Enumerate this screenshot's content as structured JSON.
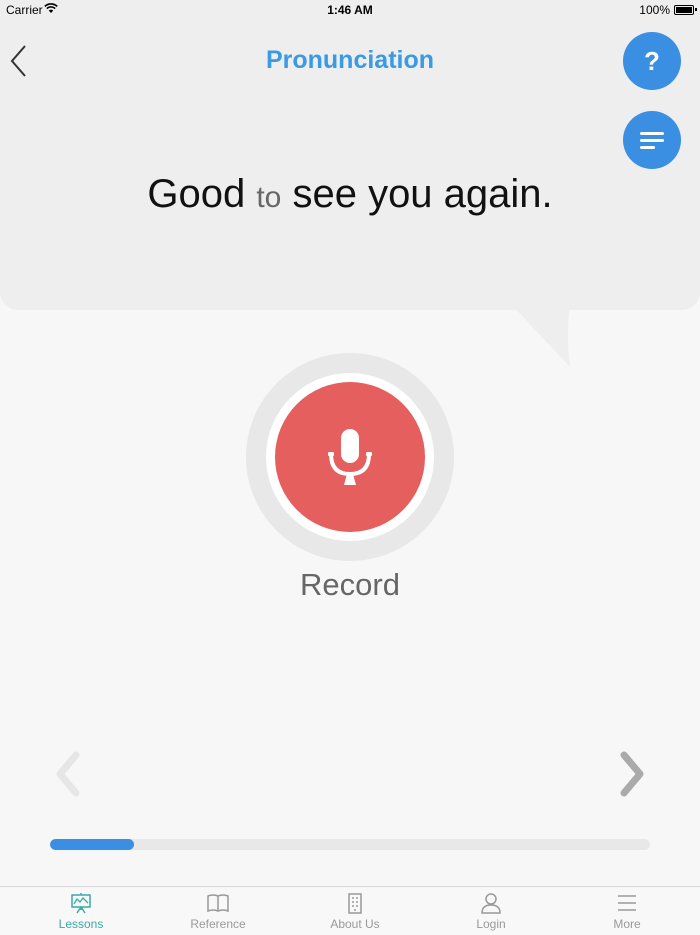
{
  "status_bar": {
    "carrier": "Carrier",
    "time": "1:46 AM",
    "battery": "100%"
  },
  "header": {
    "title": "Pronunciation",
    "help_label": "?"
  },
  "phrase": {
    "before": "Good ",
    "muted": "to",
    "after": " see you again."
  },
  "record": {
    "label": "Record"
  },
  "progress": {
    "value": 0.14
  },
  "colors": {
    "accent": "#3a8fe2",
    "record": "#e45f5d",
    "tab_active": "#3aaba6",
    "tab_inactive": "#999999"
  },
  "tabs": [
    {
      "label": "Lessons",
      "icon": "presentation-board-icon",
      "active": true
    },
    {
      "label": "Reference",
      "icon": "open-book-icon",
      "active": false
    },
    {
      "label": "About Us",
      "icon": "building-icon",
      "active": false
    },
    {
      "label": "Login",
      "icon": "person-icon",
      "active": false
    },
    {
      "label": "More",
      "icon": "hamburger-icon",
      "active": false
    }
  ]
}
